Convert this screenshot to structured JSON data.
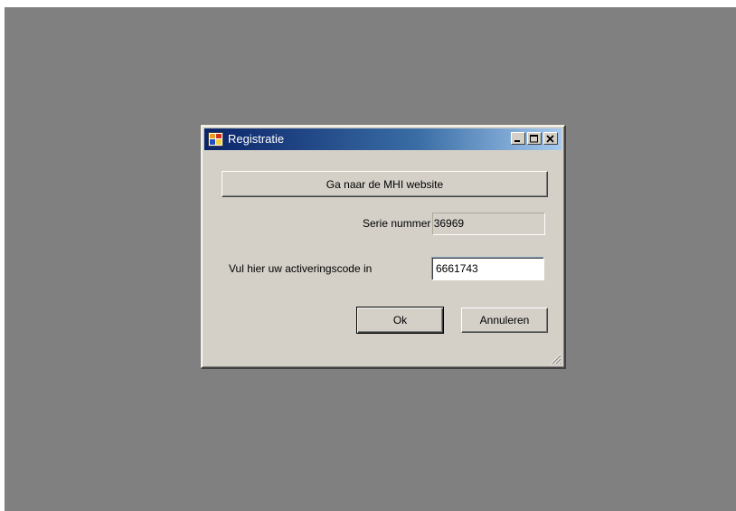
{
  "window": {
    "title": "Registratie",
    "colors": {
      "titlebar_start": "#0a246a",
      "titlebar_end": "#a6caf0",
      "face": "#d4d0c8",
      "desktop": "#808080"
    }
  },
  "titlebar_buttons": {
    "minimize_icon": "minimize-icon",
    "maximize_icon": "maximize-icon",
    "close_icon": "close-icon"
  },
  "website_button": {
    "label": "Ga naar de MHI website"
  },
  "serial": {
    "label": "Serie nummer 36969"
  },
  "activation": {
    "label": "Vul hier uw activeringscode in",
    "value": "6661743"
  },
  "actions": {
    "ok_label": "Ok",
    "cancel_label": "Annuleren"
  }
}
